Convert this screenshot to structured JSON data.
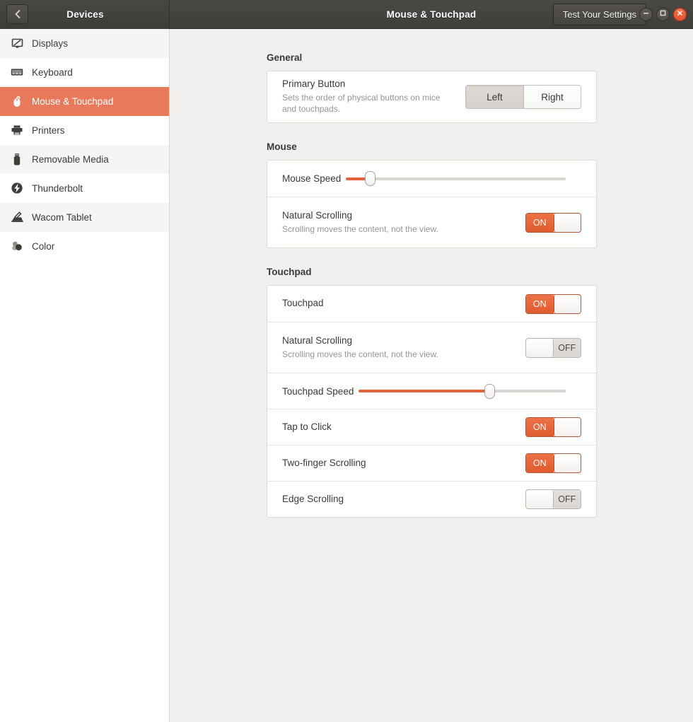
{
  "titlebar": {
    "back_icon": "chevron-left-icon",
    "left_title": "Devices",
    "center_title": "Mouse & Touchpad",
    "test_button": "Test Your Settings",
    "window_controls": [
      {
        "name": "minimize",
        "glyph": "–"
      },
      {
        "name": "maximize",
        "glyph": "□"
      },
      {
        "name": "close",
        "glyph": "✕"
      }
    ],
    "close_color": "#e2552f"
  },
  "sidebar": {
    "items": [
      {
        "label": "Displays",
        "icon": "display-icon",
        "selected": false
      },
      {
        "label": "Keyboard",
        "icon": "keyboard-icon",
        "selected": false
      },
      {
        "label": "Mouse & Touchpad",
        "icon": "mouse-icon",
        "selected": true
      },
      {
        "label": "Printers",
        "icon": "printer-icon",
        "selected": false
      },
      {
        "label": "Removable Media",
        "icon": "usb-drive-icon",
        "selected": false
      },
      {
        "label": "Thunderbolt",
        "icon": "thunderbolt-icon",
        "selected": false
      },
      {
        "label": "Wacom Tablet",
        "icon": "wacom-tablet-icon",
        "selected": false
      },
      {
        "label": "Color",
        "icon": "color-wheel-icon",
        "selected": false
      }
    ],
    "selected_color": "#e8795a"
  },
  "sections": {
    "general": {
      "title": "General",
      "primary_button": {
        "title": "Primary Button",
        "subtitle": "Sets the order of physical buttons on mice and touchpads.",
        "options": [
          "Left",
          "Right"
        ],
        "selected": "Left"
      }
    },
    "mouse": {
      "title": "Mouse",
      "speed": {
        "label": "Mouse Speed",
        "value_percent": 11
      },
      "natural_scrolling": {
        "title": "Natural Scrolling",
        "subtitle": "Scrolling moves the content, not the view.",
        "state": "ON"
      }
    },
    "touchpad": {
      "title": "Touchpad",
      "enabled": {
        "title": "Touchpad",
        "state": "ON"
      },
      "natural_scrolling": {
        "title": "Natural Scrolling",
        "subtitle": "Scrolling moves the content, not the view.",
        "state": "OFF"
      },
      "speed": {
        "label": "Touchpad Speed",
        "value_percent": 63
      },
      "tap_to_click": {
        "title": "Tap to Click",
        "state": "ON"
      },
      "two_finger_scrolling": {
        "title": "Two-finger Scrolling",
        "state": "ON"
      },
      "edge_scrolling": {
        "title": "Edge Scrolling",
        "state": "OFF"
      }
    }
  },
  "toggle_labels": {
    "on": "ON",
    "off": "OFF"
  }
}
